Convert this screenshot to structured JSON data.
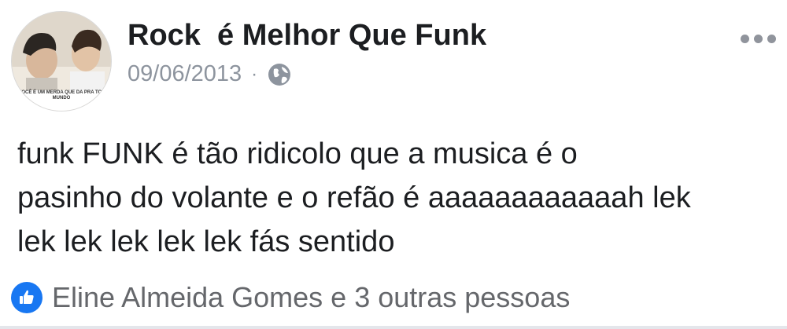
{
  "post": {
    "author": "Rock  é Melhor Que Funk",
    "date": "09/06/2013",
    "separator": "·",
    "audience_icon": "globe-icon",
    "more_icon": "more-dots-icon",
    "avatar_caption": "E VOCÊ É UM MERDA QUE\nDA PRA TODO MUNDO",
    "body": "funk FUNK  é tão ridicolo que   a musica é o\npasinho do volante e o refão é aaaaaaaaaaaah lek\nlek lek lek lek lek  fás sentido",
    "reactions_text": "Eline Almeida Gomes e 3 outras pessoas",
    "reaction_icon": "like-icon"
  },
  "colors": {
    "accent": "#1877f2",
    "meta_text": "#8d949e",
    "reaction_text": "#65676b"
  }
}
